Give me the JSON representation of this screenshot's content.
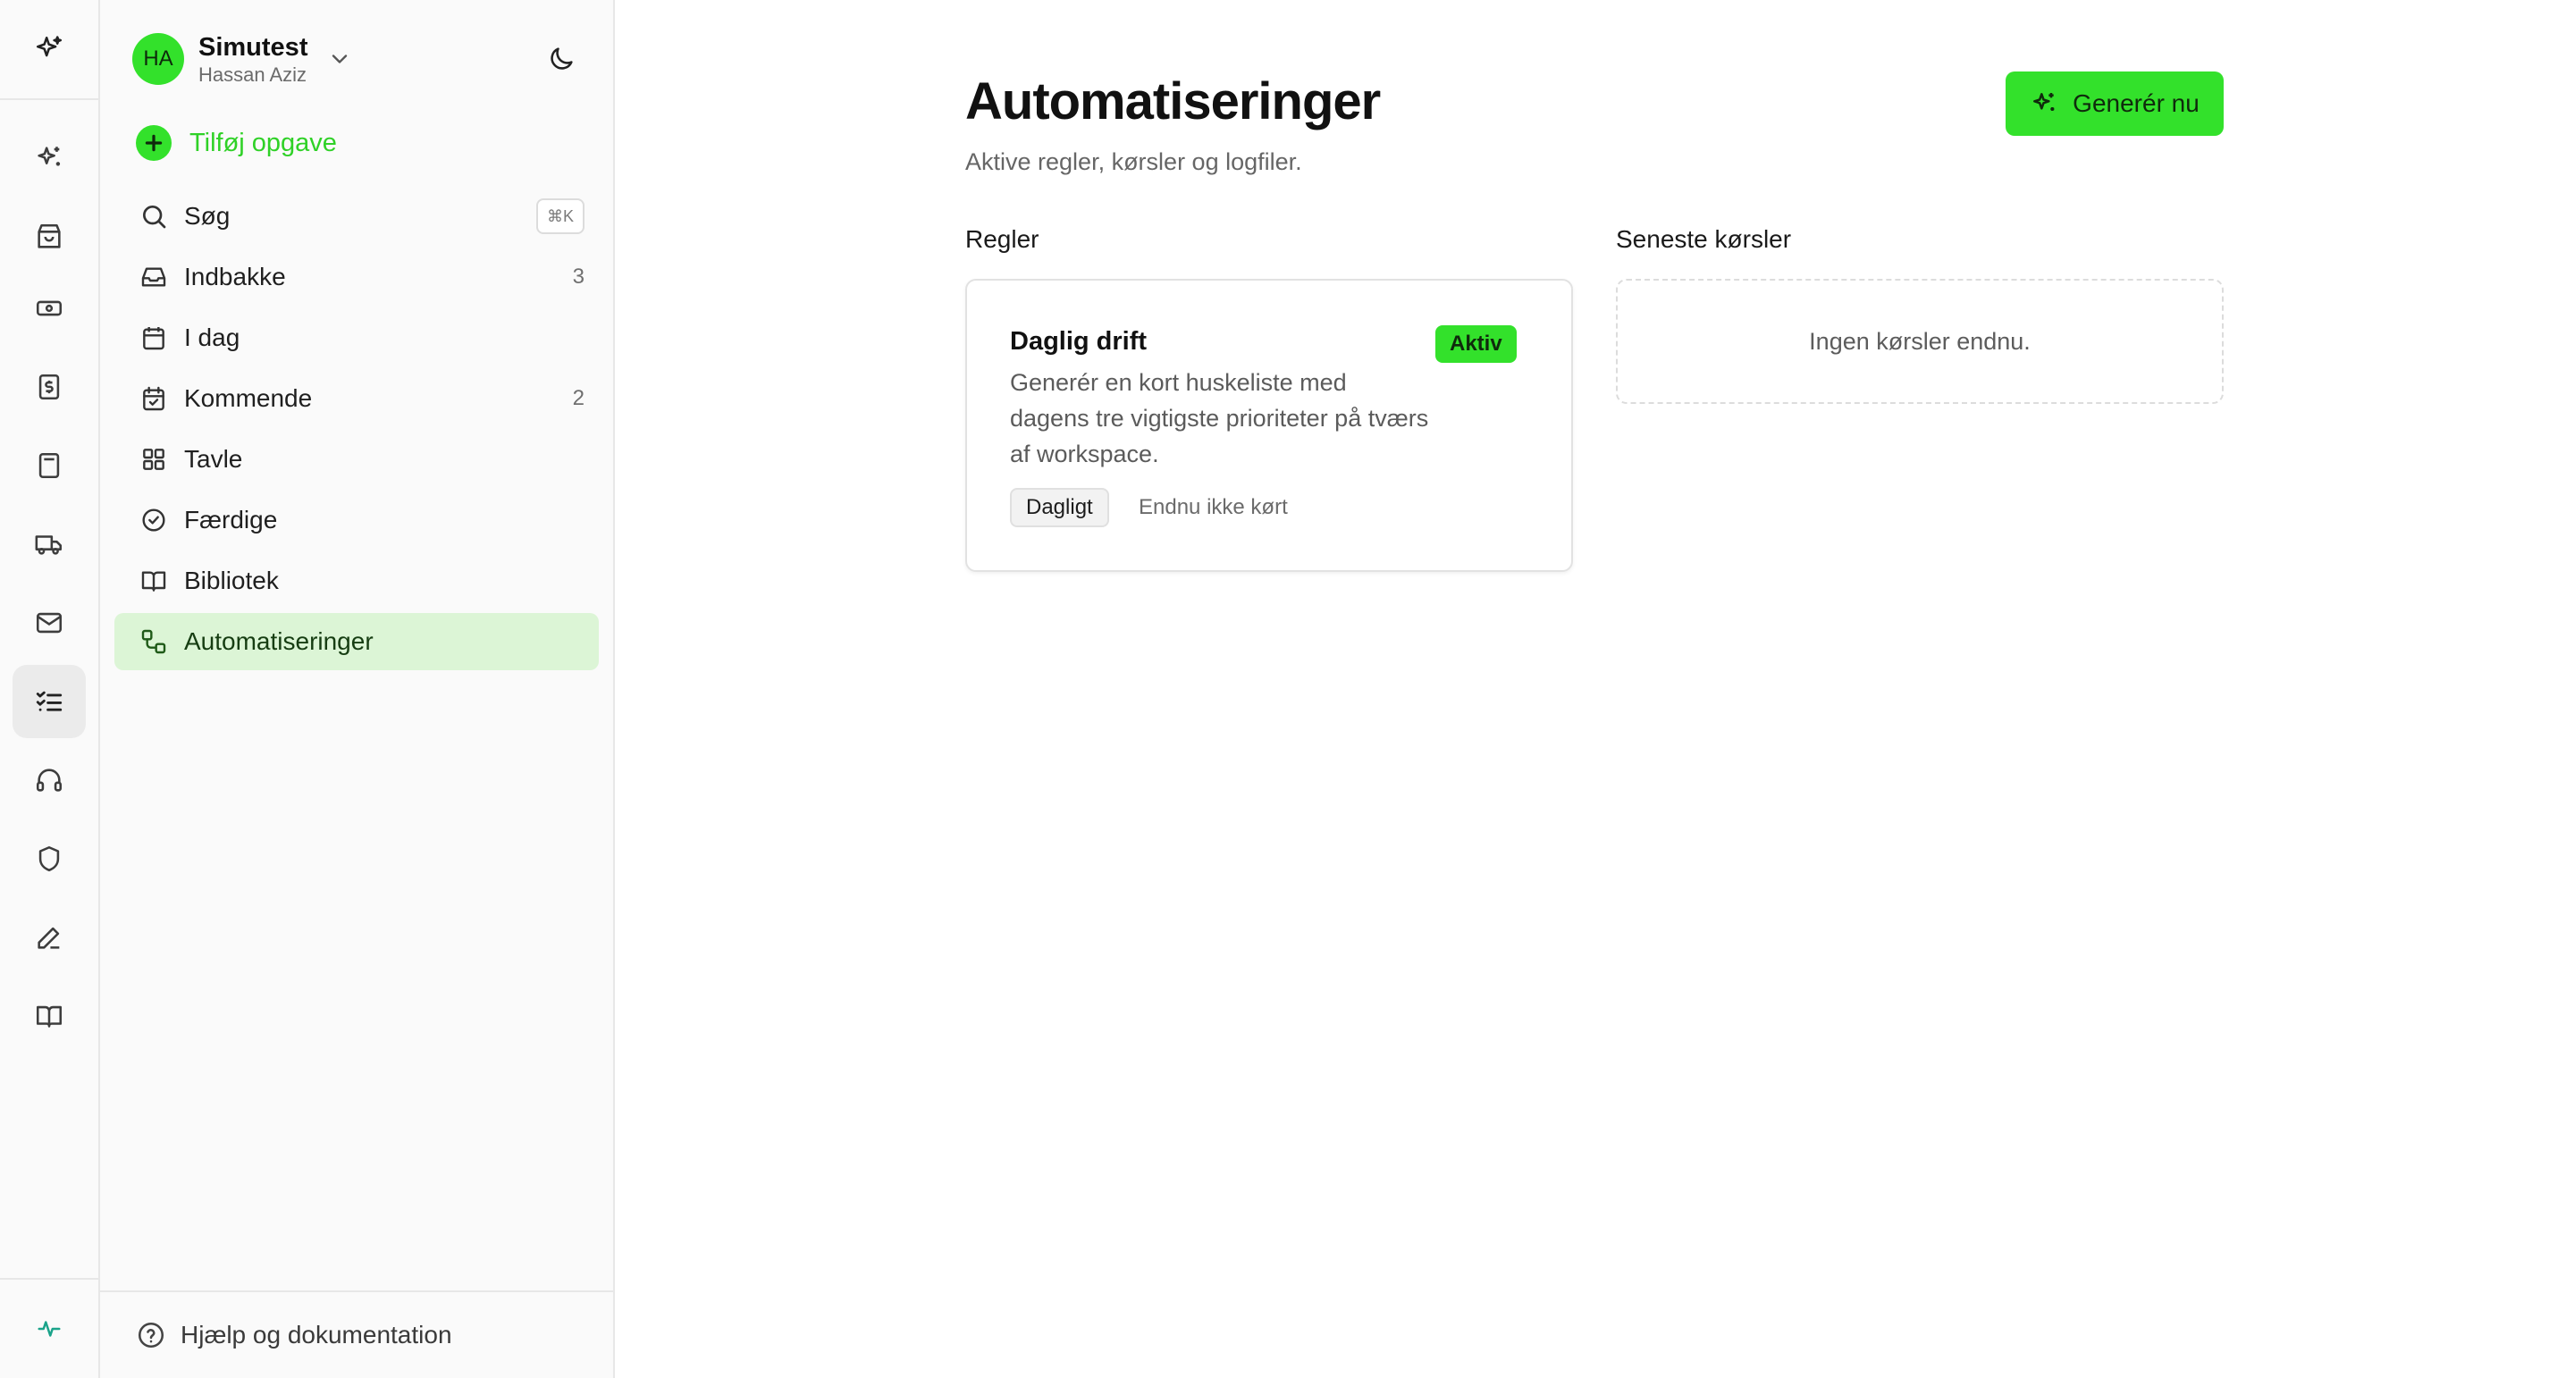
{
  "workspace": {
    "avatar_initials": "HA",
    "name": "Simutest",
    "user": "Hassan Aziz"
  },
  "sidebar": {
    "add_task_label": "Tilføj opgave",
    "items": [
      {
        "label": "Søg",
        "shortcut": "⌘K",
        "icon": "search-icon"
      },
      {
        "label": "Indbakke",
        "count": "3",
        "icon": "inbox-icon"
      },
      {
        "label": "I dag",
        "icon": "calendar-icon"
      },
      {
        "label": "Kommende",
        "count": "2",
        "icon": "calendar-check-icon"
      },
      {
        "label": "Tavle",
        "icon": "grid-icon"
      },
      {
        "label": "Færdige",
        "icon": "check-circle-icon"
      },
      {
        "label": "Bibliotek",
        "icon": "book-icon"
      },
      {
        "label": "Automatiseringer",
        "icon": "workflow-icon",
        "active": true
      }
    ],
    "footer_label": "Hjælp og dokumentation"
  },
  "rail": {
    "icons": [
      "sparkles-icon",
      "shopping-bag-icon",
      "banknote-icon",
      "receipt-dollar-icon",
      "calculator-icon",
      "truck-icon",
      "mail-icon",
      "list-checks-icon",
      "headphones-icon",
      "shield-icon",
      "pen-icon",
      "book-open-icon"
    ],
    "active_index": 7,
    "bottom_icon": "activity-icon"
  },
  "main": {
    "title": "Automatiseringer",
    "subtitle": "Aktive regler, kørsler og logfiler.",
    "generate_button": "Generér nu",
    "rules_title": "Regler",
    "runs_title": "Seneste kørsler",
    "rule": {
      "name": "Daglig drift",
      "description": "Generér en kort huskeliste med dagens tre vigtigste prioriteter på tværs af workspace.",
      "status": "Aktiv",
      "frequency": "Dagligt",
      "run_status": "Endnu ikke kørt"
    },
    "runs_empty": "Ingen kørsler endnu."
  },
  "colors": {
    "accent": "#33e12b",
    "accent_text": "#2fd127",
    "active_nav_bg": "#dcf5d6",
    "rail_active_bg": "#ebebeb"
  }
}
